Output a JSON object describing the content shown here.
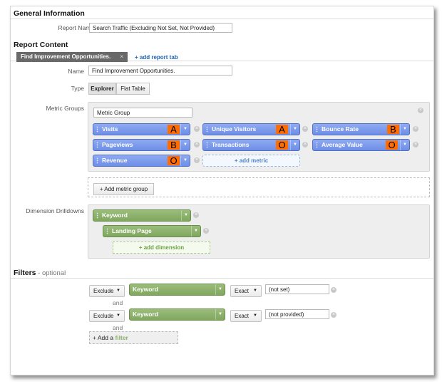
{
  "general": {
    "title": "General Information",
    "report_name_label": "Report Name",
    "report_name_value": "Search Traffic (Excluding Not Set, Not Provided)"
  },
  "content": {
    "title": "Report Content",
    "tab_label": "Find Improvement Opportunities.",
    "tab_close": "×",
    "add_tab": "+ add report tab",
    "name_label": "Name",
    "name_value": "Find Improvement Opportunities.",
    "type_label": "Type",
    "type_options": [
      "Explorer",
      "Flat Table"
    ],
    "metric_groups_label": "Metric Groups",
    "metric_group_name": "Metric Group",
    "metrics": [
      {
        "label": "Visits",
        "badge": "A"
      },
      {
        "label": "Unique Visitors",
        "badge": "A"
      },
      {
        "label": "Bounce Rate",
        "badge": "B"
      },
      {
        "label": "Pageviews",
        "badge": "B"
      },
      {
        "label": "Transactions",
        "badge": "O"
      },
      {
        "label": "Average Value",
        "badge": "O"
      },
      {
        "label": "Revenue",
        "badge": "O"
      }
    ],
    "add_metric": "+ add metric",
    "add_metric_group": "+ Add metric group",
    "dimension_label": "Dimension Drilldowns",
    "dimensions": [
      "Keyword",
      "Landing Page"
    ],
    "add_dimension": "+ add dimension"
  },
  "filters": {
    "title": "Filters",
    "optional": " - optional",
    "rows": [
      {
        "mode": "Exclude",
        "dimension": "Keyword",
        "match": "Exact",
        "value": "(not set)"
      },
      {
        "mode": "Exclude",
        "dimension": "Keyword",
        "match": "Exact",
        "value": "(not provided)"
      }
    ],
    "and_label": "and",
    "add_filter_prefix": "+ Add a ",
    "add_filter_word": "filter"
  },
  "icons": {
    "caret": "chevron-down-icon",
    "remove": "remove-icon",
    "grip": "drag-grip-icon"
  },
  "colors": {
    "metric_chip": "#7f9bec",
    "dimension_chip": "#8cb26b",
    "badge": "#ff6d00",
    "link": "#1a63b5"
  }
}
